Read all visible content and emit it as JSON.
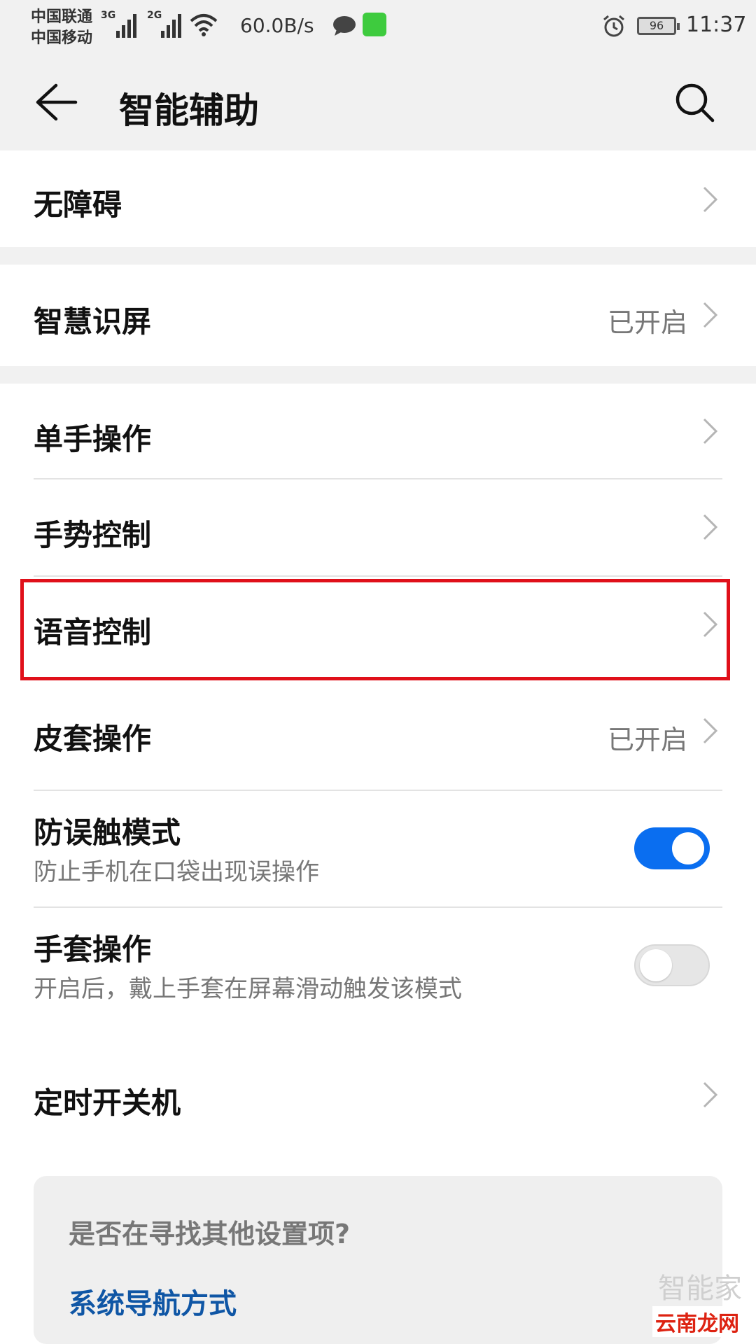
{
  "status_bar": {
    "carrier1": "中国联通",
    "carrier2": "中国移动",
    "net1": "3G",
    "net2": "2G",
    "speed": "60.0B/s",
    "battery": "96",
    "time": "11:37"
  },
  "header": {
    "title": "智能辅助"
  },
  "items": {
    "accessibility": {
      "label": "无障碍"
    },
    "smart_screen": {
      "label": "智慧识屏",
      "value": "已开启"
    },
    "one_hand": {
      "label": "单手操作"
    },
    "gesture": {
      "label": "手势控制"
    },
    "voice": {
      "label": "语音控制"
    },
    "cover": {
      "label": "皮套操作",
      "value": "已开启"
    },
    "pocket": {
      "label": "防误触模式",
      "desc": "防止手机在口袋出现误操作",
      "enabled": true
    },
    "glove": {
      "label": "手套操作",
      "desc": "开启后，戴上手套在屏幕滑动触发该模式",
      "enabled": false
    },
    "timer": {
      "label": "定时开关机"
    }
  },
  "suggestion": {
    "question": "是否在寻找其他设置项?",
    "link": "系统导航方式"
  },
  "watermark": {
    "line1": "智能家",
    "line2": "云南龙网"
  },
  "colors": {
    "accent": "#0a6ef0",
    "highlight": "#e0101a",
    "link": "#0f56a5"
  }
}
